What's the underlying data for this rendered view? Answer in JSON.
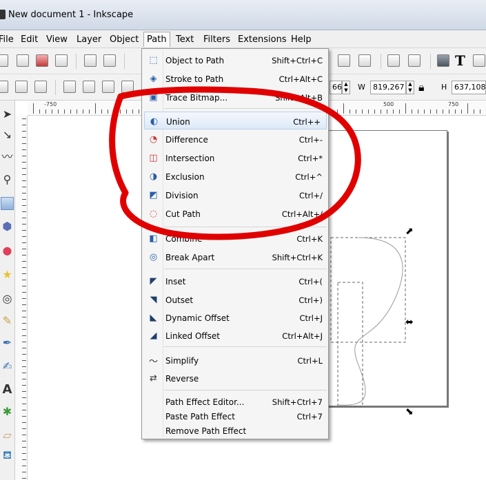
{
  "window": {
    "title": "New document 1 - Inkscape"
  },
  "menubar": {
    "items": [
      "File",
      "Edit",
      "View",
      "Layer",
      "Object",
      "Path",
      "Text",
      "Filters",
      "Extensions",
      "Help"
    ],
    "active": "Path"
  },
  "toolbar": {
    "fields": {
      "x_value": "66",
      "w_label": "W",
      "w_value": "819,267",
      "h_label": "H",
      "h_value": "637,108"
    }
  },
  "ruler": {
    "labels": [
      "-750",
      "500",
      "750"
    ]
  },
  "path_menu": {
    "items": [
      {
        "label": "Object to Path",
        "shortcut": "Shift+Ctrl+C",
        "icon": "object-to-path-icon"
      },
      {
        "label": "Stroke to Path",
        "shortcut": "Ctrl+Alt+C",
        "icon": "stroke-to-path-icon"
      },
      {
        "label": "Trace Bitmap...",
        "shortcut": "Shift+Alt+B",
        "icon": "trace-bitmap-icon"
      },
      {
        "label": "Union",
        "shortcut": "Ctrl++",
        "icon": "union-icon"
      },
      {
        "label": "Difference",
        "shortcut": "Ctrl+-",
        "icon": "difference-icon"
      },
      {
        "label": "Intersection",
        "shortcut": "Ctrl+*",
        "icon": "intersection-icon"
      },
      {
        "label": "Exclusion",
        "shortcut": "Ctrl+^",
        "icon": "exclusion-icon"
      },
      {
        "label": "Division",
        "shortcut": "Ctrl+/",
        "icon": "division-icon"
      },
      {
        "label": "Cut Path",
        "shortcut": "Ctrl+Alt+/",
        "icon": "cut-path-icon"
      },
      {
        "label": "Combine",
        "shortcut": "Ctrl+K",
        "icon": "combine-icon"
      },
      {
        "label": "Break Apart",
        "shortcut": "Shift+Ctrl+K",
        "icon": "break-apart-icon"
      },
      {
        "label": "Inset",
        "shortcut": "Ctrl+(",
        "icon": "inset-icon"
      },
      {
        "label": "Outset",
        "shortcut": "Ctrl+)",
        "icon": "outset-icon"
      },
      {
        "label": "Dynamic Offset",
        "shortcut": "Ctrl+J",
        "icon": "dynamic-offset-icon"
      },
      {
        "label": "Linked Offset",
        "shortcut": "Ctrl+Alt+J",
        "icon": "linked-offset-icon"
      },
      {
        "label": "Simplify",
        "shortcut": "Ctrl+L",
        "icon": "simplify-icon"
      },
      {
        "label": "Reverse",
        "shortcut": "",
        "icon": "reverse-icon"
      },
      {
        "label": "Path Effect Editor...",
        "shortcut": "Shift+Ctrl+7",
        "icon": ""
      },
      {
        "label": "Paste Path Effect",
        "shortcut": "Ctrl+7",
        "icon": ""
      },
      {
        "label": "Remove Path Effect",
        "shortcut": "",
        "icon": ""
      }
    ],
    "highlighted": "Union"
  },
  "annotation": {
    "color": "#e00000",
    "shape": "hand-drawn red ellipse around boolean operations"
  }
}
